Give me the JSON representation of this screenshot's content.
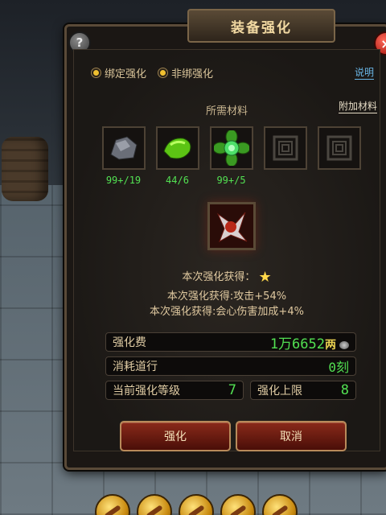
{
  "window": {
    "title": "装备强化",
    "help_label": "?",
    "close_label": "×"
  },
  "options": {
    "bound_label": "绑定强化",
    "unbound_label": "非绑强化",
    "selected": "bound",
    "explain_label": "说明"
  },
  "materials": {
    "title": "所需材料",
    "extra_label": "附加材料",
    "items": [
      {
        "name": "ore-icon",
        "count": "99+/19"
      },
      {
        "name": "green-crystal-icon",
        "count": "44/6"
      },
      {
        "name": "green-flower-icon",
        "count": "99+/5"
      },
      {
        "name": "empty-slot-icon",
        "count": ""
      },
      {
        "name": "empty-slot-icon",
        "count": ""
      }
    ]
  },
  "result": {
    "line1": "本次强化获得：",
    "line2": "本次强化获得:攻击+54%",
    "line3": "本次强化获得:会心伤害加成+4%"
  },
  "stats": {
    "fee_label": "强化费",
    "fee_value": "1万6652",
    "fee_unit": "两",
    "consume_label": "消耗道行",
    "consume_value": "0刻",
    "level_label": "当前强化等级",
    "level_value": "7",
    "limit_label": "强化上限",
    "limit_value": "8"
  },
  "buttons": {
    "enhance": "强化",
    "cancel": "取消"
  },
  "colors": {
    "accent_green": "#52e052",
    "gold": "#f0c030",
    "link_blue": "#6ab6e6"
  }
}
